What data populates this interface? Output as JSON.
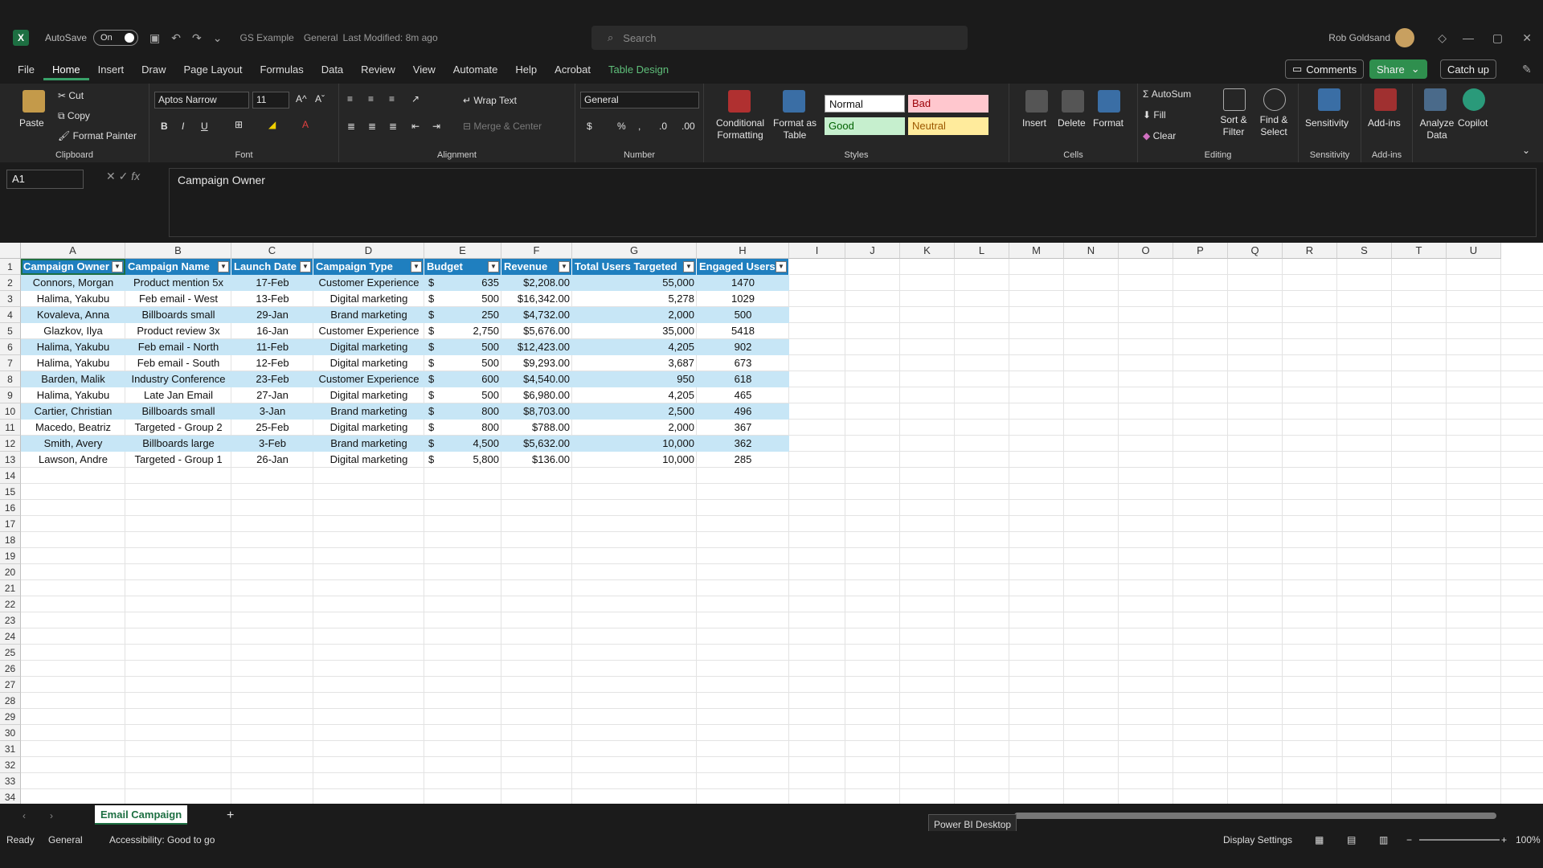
{
  "titlebar": {
    "autosave": "AutoSave",
    "toggle": "On",
    "doc": "GS Example",
    "label": "General",
    "modified": "Last Modified: 8m ago",
    "search": "Search",
    "user": "Rob Goldsand"
  },
  "menu": [
    "File",
    "Home",
    "Insert",
    "Draw",
    "Page Layout",
    "Formulas",
    "Data",
    "Review",
    "View",
    "Automate",
    "Help",
    "Acrobat",
    "Table Design"
  ],
  "topbuttons": {
    "comments": "Comments",
    "share": "Share",
    "catchup": "Catch up"
  },
  "ribbon": {
    "clipboard": {
      "paste": "Paste",
      "cut": "Cut",
      "copy": "Copy",
      "painter": "Format Painter",
      "label": "Clipboard"
    },
    "font": {
      "name": "Aptos Narrow",
      "size": "11",
      "label": "Font"
    },
    "alignment": {
      "wrap": "Wrap Text",
      "merge": "Merge & Center",
      "label": "Alignment"
    },
    "number": {
      "format": "General",
      "label": "Number"
    },
    "styles": {
      "cond": "Conditional Formatting",
      "fmt_table": "Format as Table",
      "normal": "Normal",
      "bad": "Bad",
      "good": "Good",
      "neutral": "Neutral",
      "label": "Styles"
    },
    "cells": {
      "insert": "Insert",
      "delete": "Delete",
      "format": "Format",
      "label": "Cells"
    },
    "editing": {
      "autosum": "AutoSum",
      "fill": "Fill",
      "clear": "Clear",
      "sort": "Sort & Filter",
      "find": "Find & Select",
      "label": "Editing"
    },
    "sensitivity": {
      "btn": "Sensitivity",
      "label": "Sensitivity"
    },
    "addins": {
      "btn": "Add-ins",
      "label": "Add-ins"
    },
    "analyze": "Analyze Data",
    "copilot": "Copilot"
  },
  "formula": {
    "namebox": "A1",
    "content": "Campaign Owner"
  },
  "columns": [
    "A",
    "B",
    "C",
    "D",
    "E",
    "F",
    "G",
    "H",
    "I",
    "J",
    "K",
    "L",
    "M",
    "N",
    "O",
    "P",
    "Q",
    "R",
    "S",
    "T",
    "U"
  ],
  "rows": [
    "1",
    "2",
    "3",
    "4",
    "5",
    "6",
    "7",
    "8",
    "9",
    "10",
    "11",
    "12",
    "13",
    "14",
    "15",
    "16",
    "17",
    "18",
    "19",
    "20",
    "21",
    "22",
    "23",
    "24",
    "25",
    "26",
    "27",
    "28",
    "29",
    "30",
    "31",
    "32",
    "33",
    "34"
  ],
  "table": {
    "headers": [
      "Campaign Owner",
      "Campaign Name",
      "Launch Date",
      "Campaign Type",
      "Budget",
      "Revenue",
      "Total Users Targeted",
      "Engaged Users"
    ],
    "rows": [
      [
        "Connors, Morgan",
        "Product mention 5x",
        "17-Feb",
        "Customer Experience",
        "$",
        "635",
        "$2,208.00",
        "55,000",
        "1470"
      ],
      [
        "Halima, Yakubu",
        "Feb email - West",
        "13-Feb",
        "Digital marketing",
        "$",
        "500",
        "$16,342.00",
        "5,278",
        "1029"
      ],
      [
        "Kovaleva, Anna",
        "Billboards small",
        "29-Jan",
        "Brand marketing",
        "$",
        "250",
        "$4,732.00",
        "2,000",
        "500"
      ],
      [
        "Glazkov, Ilya",
        "Product review 3x",
        "16-Jan",
        "Customer Experience",
        "$",
        "2,750",
        "$5,676.00",
        "35,000",
        "5418"
      ],
      [
        "Halima, Yakubu",
        "Feb email - North",
        "11-Feb",
        "Digital marketing",
        "$",
        "500",
        "$12,423.00",
        "4,205",
        "902"
      ],
      [
        "Halima, Yakubu",
        "Feb email - South",
        "12-Feb",
        "Digital marketing",
        "$",
        "500",
        "$9,293.00",
        "3,687",
        "673"
      ],
      [
        "Barden, Malik",
        "Industry Conference",
        "23-Feb",
        "Customer Experience",
        "$",
        "600",
        "$4,540.00",
        "950",
        "618"
      ],
      [
        "Halima, Yakubu",
        "Late Jan Email",
        "27-Jan",
        "Digital marketing",
        "$",
        "500",
        "$6,980.00",
        "4,205",
        "465"
      ],
      [
        "Cartier, Christian",
        "Billboards small",
        "3-Jan",
        "Brand marketing",
        "$",
        "800",
        "$8,703.00",
        "2,500",
        "496"
      ],
      [
        "Macedo, Beatriz",
        "Targeted - Group 2",
        "25-Feb",
        "Digital marketing",
        "$",
        "800",
        "$788.00",
        "2,000",
        "367"
      ],
      [
        "Smith, Avery",
        "Billboards large",
        "3-Feb",
        "Brand marketing",
        "$",
        "4,500",
        "$5,632.00",
        "10,000",
        "362"
      ],
      [
        "Lawson, Andre",
        "Targeted - Group 1",
        "26-Jan",
        "Digital marketing",
        "$",
        "5,800",
        "$136.00",
        "10,000",
        "285"
      ]
    ]
  },
  "sheet": {
    "tab": "Email Campaign",
    "tooltip": "Power BI Desktop"
  },
  "status": {
    "ready": "Ready",
    "label": "General",
    "access": "Accessibility: Good to go",
    "display": "Display Settings",
    "zoom": "100%"
  }
}
